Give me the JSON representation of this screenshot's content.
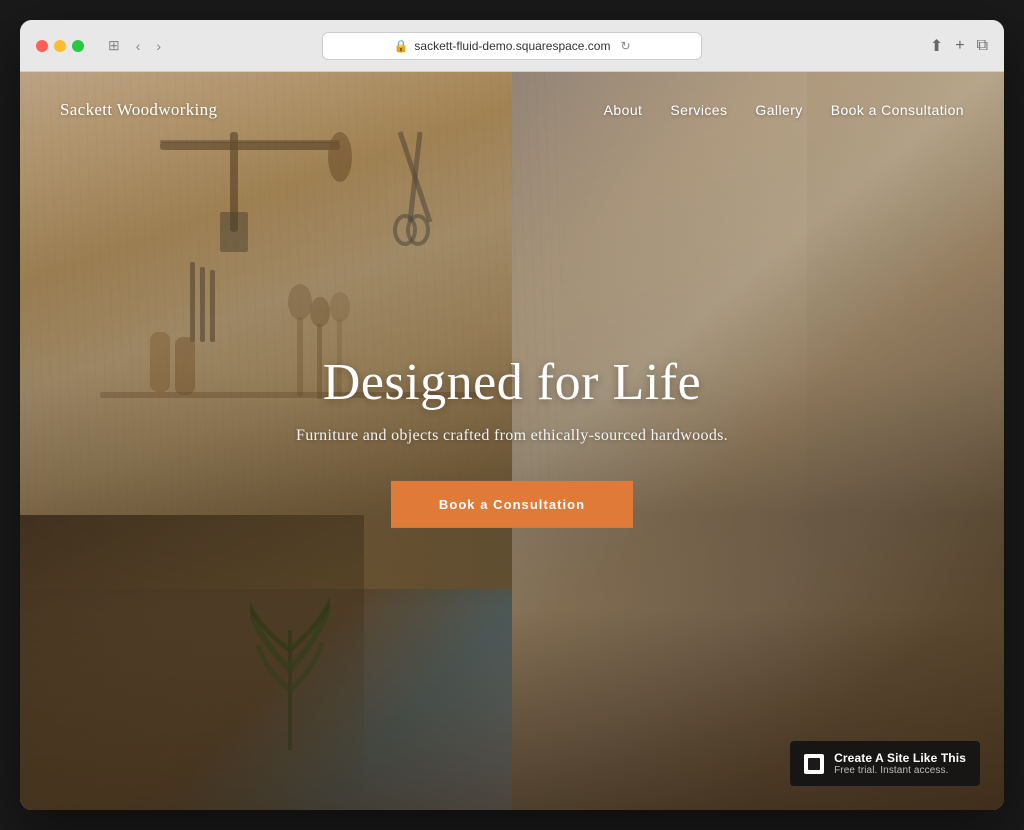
{
  "browser": {
    "url": "sackett-fluid-demo.squarespace.com",
    "reload_icon": "↻"
  },
  "nav": {
    "logo": "Sackett Woodworking",
    "links": [
      {
        "label": "About",
        "id": "about"
      },
      {
        "label": "Services",
        "id": "services"
      },
      {
        "label": "Gallery",
        "id": "gallery"
      },
      {
        "label": "Book a Consultation",
        "id": "book"
      }
    ]
  },
  "hero": {
    "title": "Designed for Life",
    "subtitle": "Furniture and objects crafted from ethically-sourced hardwoods.",
    "cta_label": "Book a Consultation"
  },
  "badge": {
    "title": "Create A Site Like This",
    "subtitle": "Free trial. Instant access."
  }
}
